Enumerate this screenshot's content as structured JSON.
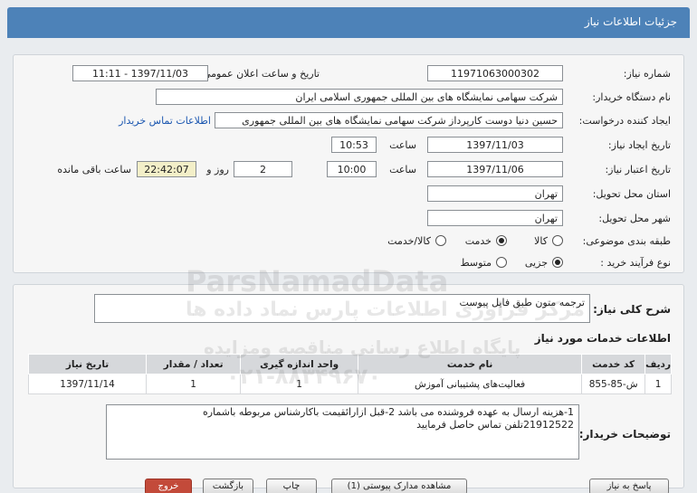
{
  "header": {
    "title": "جزئیات اطلاعات نیاز"
  },
  "form": {
    "need_number": {
      "label": "شماره نیاز:",
      "value": "1197106300030​2"
    },
    "announce_datetime": {
      "label": "تاریخ و ساعت اعلان عمومی:",
      "value": "1397/11/03 - 11:11"
    },
    "buyer_org": {
      "label": "نام دستگاه خریدار:",
      "value": "شرکت سهامی نمایشگاه های بین المللی جمهوری اسلامی ایران"
    },
    "requester": {
      "label": "ایجاد کننده درخواست:",
      "value": "حسین دنیا دوست کارپرداز شرکت سهامی نمایشگاه های بین المللی جمهوری",
      "contact_link": "اطلاعات تماس خریدار"
    },
    "created": {
      "label": "تاریخ ایجاد نیاز:",
      "date": "1397/11/03",
      "time_label": "ساعت",
      "time": "10:53"
    },
    "validity": {
      "label": "تاریخ اعتبار نیاز:",
      "date": "1397/11/06",
      "time_label": "ساعت",
      "time": "10:00",
      "days": "2",
      "days_label": "روز و",
      "remaining": "22:42:07",
      "remaining_label": "ساعت باقی مانده"
    },
    "province": {
      "label": "استان محل تحویل:",
      "value": "تهران"
    },
    "city": {
      "label": "شهر محل تحویل:",
      "value": "تهران"
    },
    "category": {
      "label": "طبقه بندی موضوعی:",
      "options": [
        "کالا",
        "خدمت",
        "کالا/خدمت"
      ],
      "selected": "خدمت"
    },
    "process": {
      "label": "نوع فرآیند خرید :",
      "options": [
        "جزیی",
        "متوسط"
      ],
      "selected": "جزیی"
    }
  },
  "summary": {
    "label": "شرح کلی نیاز:",
    "value": "ترجمه متون طبق فایل پیوست"
  },
  "services": {
    "title": "اطلاعات خدمات مورد نیاز",
    "columns": [
      "ردیف",
      "کد خدمت",
      "نام خدمت",
      "واحد اندازه گیری",
      "تعداد / مقدار",
      "تاریخ نیاز"
    ],
    "rows": [
      {
        "row": "1",
        "code": "ش-85-855",
        "name": "فعالیت‌های پشتیبانی آموزش",
        "unit": "1",
        "qty": "1",
        "date": "1397/11/14"
      }
    ]
  },
  "buyer_notes": {
    "label": "توضیحات خریدار:",
    "line1": "1-هزینه ارسال  به عهده فروشنده می باشد 2-قبل ازارائقیمت باکارشناس مربوطه باشماره",
    "line2": "21912522تلفن تماس حاصل فرمایید"
  },
  "buttons": {
    "reply": "پاسخ به نیاز",
    "view_docs": "مشاهده مدارک پیوستی (1)",
    "print": "چاپ",
    "back": "بازگشت",
    "exit": "خروج"
  },
  "watermark": {
    "brand": "ParsNamadData",
    "line1": "مرکز فراوری اطلاعات پارس نماد داده ها",
    "line2": "پایگاه اطلاع رسانی مناقصه ومزایده",
    "line3": "۰۲۱-۸۸۳۴۹۶۷۰"
  },
  "colors": {
    "header": "#4d82b8",
    "link": "#1a56b0",
    "remaining_bg": "#f3efc8",
    "exit_button": "#c34a3a"
  }
}
